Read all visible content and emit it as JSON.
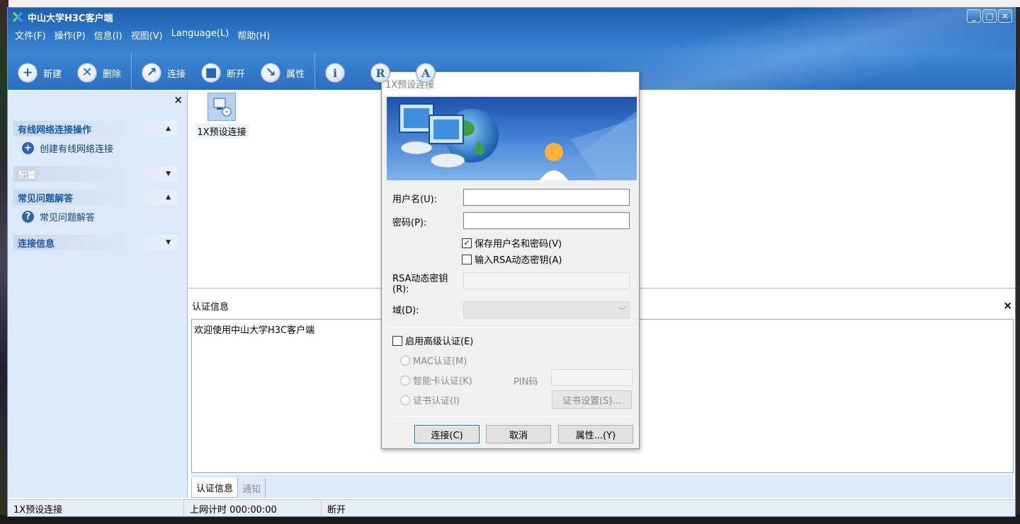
{
  "window": {
    "title": "中山大学H3C客户端",
    "controls": {
      "minimize": "_",
      "maximize": "□",
      "close": "✕"
    }
  },
  "menu": [
    "文件(F)",
    "操作(P)",
    "信息(I)",
    "视图(V)",
    "Language(L)",
    "帮助(H)"
  ],
  "toolbar": {
    "new_label": "新建",
    "delete_label": "删除",
    "connect_label": "连接",
    "disconnect_label": "断开",
    "properties_label": "属性",
    "info_glyph": "i",
    "r_glyph": "R",
    "a_glyph": "A"
  },
  "sidebar": {
    "close_glyph": "×",
    "sections": [
      {
        "title": "有线网络连接操作",
        "arrow": "▲",
        "items": [
          {
            "label": "创建有线网络连接",
            "icon": "plus-icon"
          }
        ]
      },
      {
        "title": "配置",
        "arrow": "▼",
        "items": []
      },
      {
        "title": "常见问题解答",
        "arrow": "▲",
        "items": [
          {
            "label": "常见问题解答",
            "icon": "help-icon"
          }
        ]
      },
      {
        "title": "连接信息",
        "arrow": "▼",
        "items": []
      }
    ]
  },
  "connection_tile": {
    "label": "1X预设连接"
  },
  "auth_panel": {
    "header": "认证信息",
    "close_glyph": "×",
    "message": "欢迎使用中山大学H3C客户端",
    "tabs": [
      "认证信息",
      "通知"
    ]
  },
  "statusbar": {
    "connection": "1X预设连接",
    "timer": "上网计时 000:00:00",
    "state": "断开"
  },
  "dialog": {
    "title": "1X预设连接",
    "username_label": "用户名(U):",
    "password_label": "密码(P):",
    "save_credentials_label": "保存用户名和密码(V)",
    "save_credentials_checked": "✓",
    "rsa_checkbox_label": "输入RSA动态密钥(A)",
    "rsa_key_label": "RSA动态密钥(R):",
    "domain_label": "域(D):",
    "advanced_auth_label": "启用高级认证(E)",
    "mac_auth_label": "MAC认证(M)",
    "smartcard_auth_label": "智能卡认证(K)",
    "pin_label": "PIN码",
    "cert_auth_label": "证书认证(I)",
    "cert_settings_label": "证书设置(S)...",
    "connect_button": "连接(C)",
    "cancel_button": "取消",
    "properties_button": "属性...(Y)"
  },
  "colors": {
    "titlebar": "#2f77c8",
    "sidebar_bg": "#dce9f8",
    "section_title": "#1e58a8",
    "dialog_bg": "#f0f0f0"
  }
}
